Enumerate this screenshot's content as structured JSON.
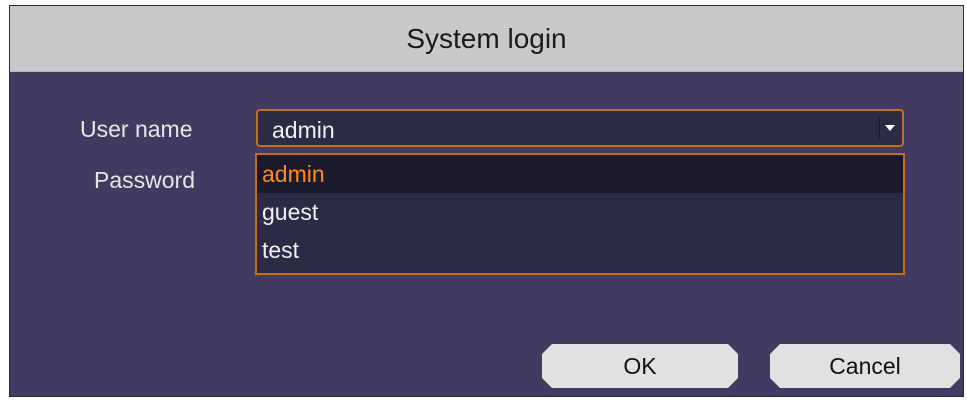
{
  "dialog": {
    "title": "System login",
    "user_label": "User name",
    "password_label": "Password",
    "user_select": {
      "value": "admin",
      "options": [
        "admin",
        "guest",
        "test"
      ],
      "selected_index": 0
    },
    "ok_label": "OK",
    "cancel_label": "Cancel"
  },
  "colors": {
    "title_bar": "#c9c9c9",
    "body": "#433a62",
    "accent_border": "#c1701e",
    "selected_text": "#ff8a1a",
    "button": "#e1e1e1"
  },
  "icons": {
    "dropdown": "chevron-down-icon"
  }
}
